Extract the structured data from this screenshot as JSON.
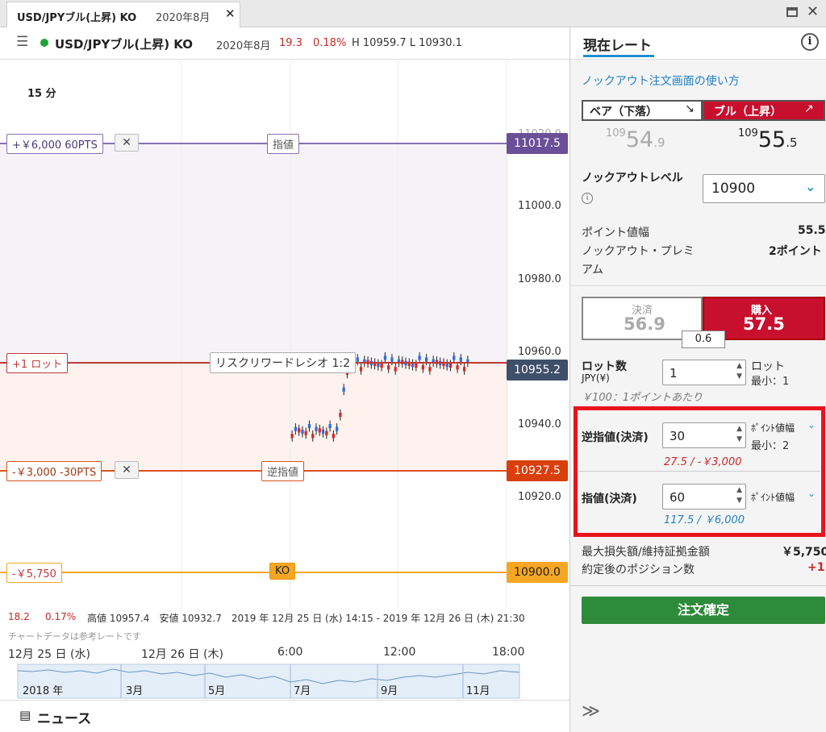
{
  "tab": {
    "title": "USD/JPYブル(上昇) KO",
    "contract": "2020年8月",
    "close": "✕"
  },
  "window": {
    "restore": "",
    "close": "✕"
  },
  "header": {
    "title": "USD/JPYブル(上昇) KO",
    "contract": "2020年8月",
    "change": "19.3",
    "change_pct": "0.18%",
    "high_low": "H 10959.7 L 10930.1"
  },
  "chart": {
    "timeframe": "15 分",
    "y_ticks": [
      "11000.0",
      "10980.0",
      "10960.0",
      "10940.0",
      "10920.0"
    ],
    "limit": {
      "left_label": "+￥6,000 60PTS",
      "center_label": "指値",
      "price": "11017.5",
      "hidden_tick": "11020.0"
    },
    "position": {
      "left_label": "+1 ロット",
      "center_label": "リスクリワードレシオ 1:2",
      "price": "10955.2"
    },
    "stop": {
      "left_label": "-￥3,000 -30PTS",
      "center_label": "逆指値",
      "price": "10927.5"
    },
    "ko": {
      "left_label": "-￥5,750",
      "center_label": "KO",
      "price": "10900.0"
    },
    "x_ticks": [
      "6:00",
      "12:00",
      "18:00"
    ],
    "dates": [
      "12月 25 日 (水)",
      "12月 26 日 (木)"
    ],
    "colors": {
      "limit": "#7b5ea7",
      "position": "#c0393b",
      "stop": "#d9531e",
      "ko": "#f5a623",
      "candle_up": "#2f6fd6",
      "candle_down": "#d62828"
    }
  },
  "chart_data": {
    "type": "candlestick",
    "x": [
      "12-26 08:15",
      "08:30",
      "08:45",
      "09:00",
      "09:15",
      "09:30",
      "09:45",
      "10:00",
      "10:15",
      "10:30",
      "10:45",
      "11:00",
      "11:15",
      "11:30",
      "11:45",
      "12:00",
      "12:15",
      "12:30",
      "12:45",
      "13:00",
      "13:15",
      "13:30",
      "13:45",
      "14:00",
      "14:15",
      "14:30",
      "14:45",
      "15:00",
      "15:15",
      "15:30",
      "15:45",
      "16:00",
      "16:15",
      "16:30",
      "16:45",
      "17:00",
      "17:15",
      "17:30",
      "17:45",
      "18:00",
      "18:15",
      "18:30",
      "18:45",
      "19:00",
      "19:15",
      "19:30",
      "19:45",
      "20:00",
      "20:15",
      "20:30",
      "20:45",
      "21:00"
    ],
    "y_range": [
      10880,
      11040
    ]
  },
  "footer": {
    "change": "18.2",
    "pct": "0.17%",
    "stats": "高値 10957.4　安値 10932.7　2019 年 12月 25 日 (水) 14:15 - 2019 年 12月 26 日 (木) 21:30",
    "note": "チャートデータは参考レートです"
  },
  "timeline": {
    "labels": [
      "2018 年",
      "3月",
      "5月",
      "7月",
      "9月",
      "11月"
    ]
  },
  "news": {
    "label": "ニュース"
  },
  "panel": {
    "tab_label": "現在レート",
    "info": "i",
    "howto": "ノックアウト注文画面の使い方",
    "bear_label": "ベア（下落）",
    "bear_arrow": "↘",
    "bull_label": "ブル（上昇）",
    "bull_arrow": "↗",
    "bear_price_small": "109",
    "bear_price_big": "54",
    "bear_price_dec": ".9",
    "bull_price_small": "109",
    "bull_price_big": "55",
    "bull_price_dec": ".5",
    "ko_level_label": "ノックアウトレベル",
    "ko_level_value": "10900",
    "point_width_label": "ポイント値幅",
    "point_width_value": "55.5",
    "premium_label_1": "ノックアウト・プレミ",
    "premium_label_2": "アム",
    "premium_value": "2ポイント",
    "settle_label": "決済",
    "settle_value": "56.9",
    "buy_label": "購入",
    "buy_value": "57.5",
    "spread": "0.6",
    "lots_label": "ロット数",
    "lots_sub": "JPY(¥)",
    "lots_value": "1",
    "lots_unit": "ロット",
    "lots_min": "最小：1",
    "lots_hint": "￥100：1ポイントあたり",
    "stop_label": "逆指値(決済)",
    "stop_value": "30",
    "stop_unit": "ﾎﾟｲﾝﾄ値幅",
    "stop_min": "最小：2",
    "stop_hint": "27.5 / -￥3,000",
    "limit_label": "指値(決済)",
    "limit_value": "60",
    "limit_unit": "ﾎﾟｲﾝﾄ値幅",
    "limit_hint": "117.5 / ￥6,000",
    "maxloss_label": "最大損失額/維持証拠金額",
    "maxloss_value": "￥5,750",
    "positions_label": "約定後のポジション数",
    "positions_value": "+1",
    "confirm_label": "注文確定",
    "expand": "≫"
  }
}
